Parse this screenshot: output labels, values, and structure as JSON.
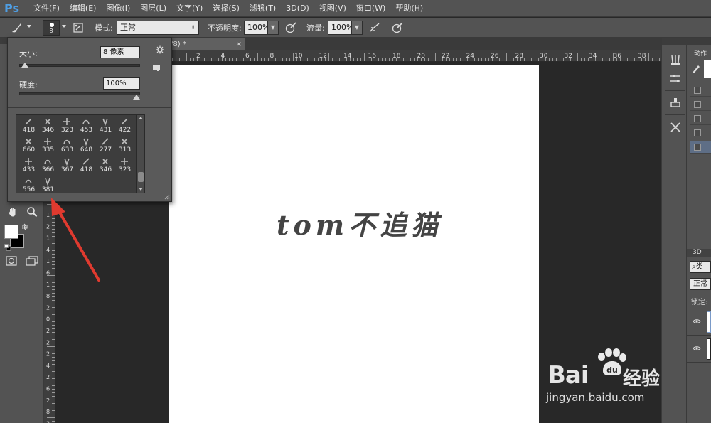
{
  "app": {
    "logo": "Ps"
  },
  "menu": [
    "文件(F)",
    "编辑(E)",
    "图像(I)",
    "图层(L)",
    "文字(Y)",
    "选择(S)",
    "滤镜(T)",
    "3D(D)",
    "视图(V)",
    "窗口(W)",
    "帮助(H)"
  ],
  "options": {
    "brush_size_badge": "8",
    "mode_label": "模式:",
    "mode_value": "正常",
    "opacity_label": "不透明度:",
    "opacity_value": "100%",
    "flow_label": "流量:",
    "flow_value": "100%"
  },
  "document": {
    "tab_title": "/8) *",
    "tab_close": "×",
    "canvas_text": "tom不追猫",
    "hruler_labels": [
      "2",
      "4",
      "6",
      "8",
      "10",
      "12",
      "14",
      "16",
      "18",
      "20",
      "22",
      "24",
      "26",
      "28",
      "30",
      "32",
      "34",
      "36",
      "38",
      "40"
    ],
    "vruler_labels": [
      "1",
      "2",
      "1",
      "4",
      "1",
      "6",
      "1",
      "8",
      "2",
      "0",
      "2",
      "2",
      "2",
      "4",
      "2",
      "6",
      "2",
      "8",
      "3"
    ]
  },
  "brush_panel": {
    "size_label": "大小:",
    "size_value": "8 像素",
    "size_fraction": 0.02,
    "hardness_label": "硬度:",
    "hardness_value": "100%",
    "hardness_fraction": 1.0,
    "presets": [
      "418",
      "346",
      "323",
      "453",
      "431",
      "422",
      "660",
      "335",
      "633",
      "648",
      "277",
      "313",
      "433",
      "366",
      "367",
      "418",
      "346",
      "323",
      "556",
      "381"
    ]
  },
  "right_panel": {
    "actions_tab": "动作",
    "threed_tab": "3D",
    "search_label": "类",
    "blend_value": "正常",
    "lock_label": "锁定:"
  },
  "watermark": {
    "brand": "Bai",
    "brand2": "经验",
    "url": "jingyan.baidu.com"
  },
  "colors": {
    "accent": "#4f9ee3",
    "arrow": "#e03a2f",
    "canvas_text": "#444444"
  }
}
